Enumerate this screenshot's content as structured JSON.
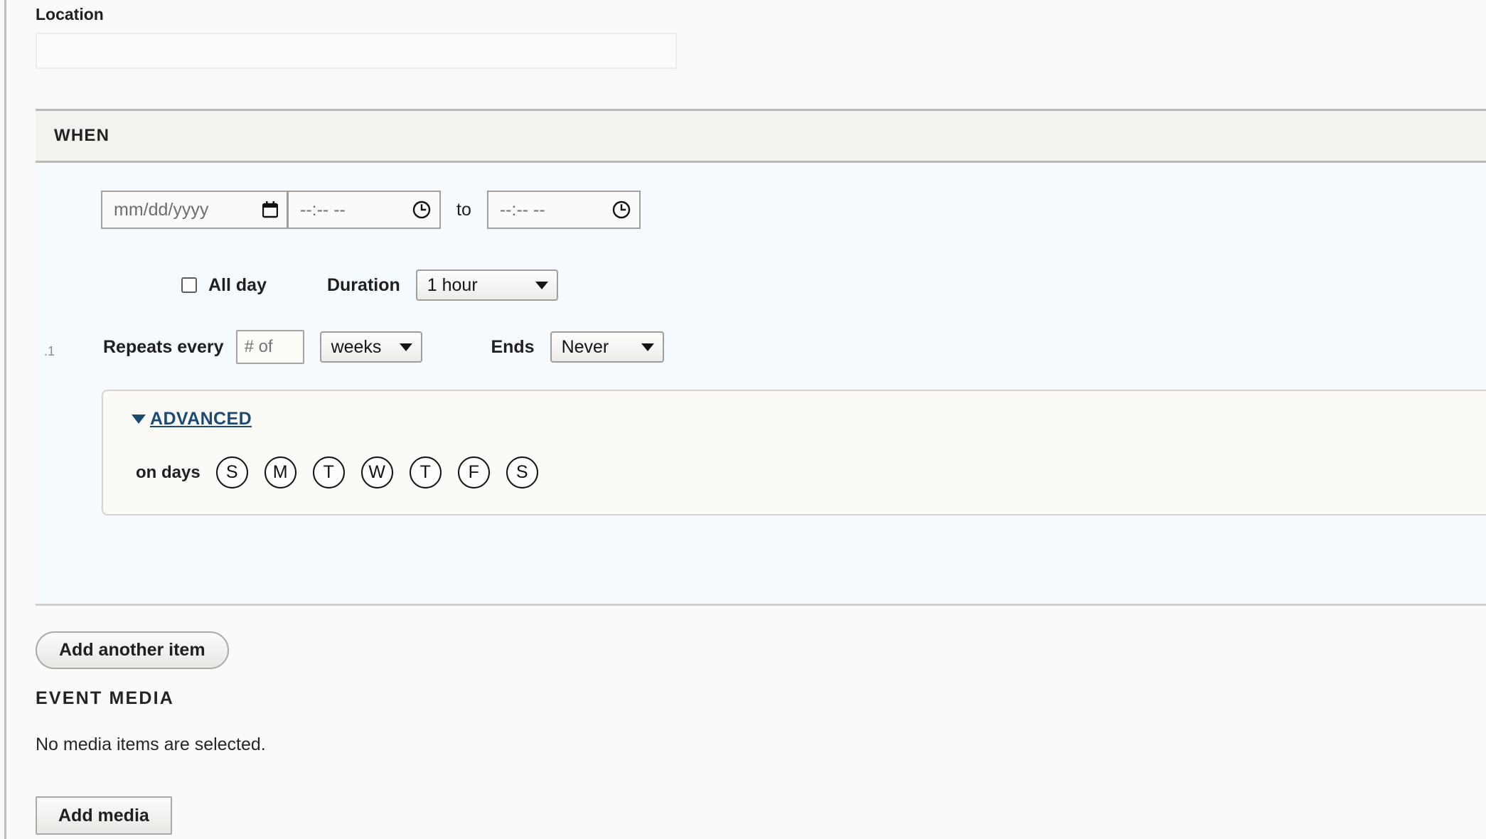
{
  "location": {
    "label": "Location",
    "value": "",
    "placeholder": ""
  },
  "when": {
    "section_title": "WHEN",
    "date": {
      "placeholder": "mm/dd/yyyy",
      "value": "",
      "icon": "calendar-icon"
    },
    "start_time": {
      "placeholder": "--:-- --",
      "value": "",
      "icon": "clock-icon"
    },
    "to_label": "to",
    "end_time": {
      "placeholder": "--:-- --",
      "value": "",
      "icon": "clock-icon"
    },
    "all_day": {
      "label": "All day",
      "checked": false
    },
    "duration": {
      "label": "Duration",
      "value": "1 hour",
      "options": [
        "1 hour"
      ]
    },
    "repeats": {
      "label": "Repeats every",
      "count_placeholder": "# of",
      "count_value": "",
      "unit_value": "weeks",
      "unit_options": [
        "weeks"
      ]
    },
    "ends": {
      "label": "Ends",
      "value": "Never",
      "options": [
        "Never"
      ]
    },
    "tiny_mark": ".1",
    "advanced": {
      "link_label": "ADVANCED",
      "caret": "triangle-down-icon",
      "on_days_label": "on days",
      "days": [
        {
          "letter": "S",
          "name": "sunday",
          "selected": false
        },
        {
          "letter": "M",
          "name": "monday",
          "selected": false
        },
        {
          "letter": "T",
          "name": "tuesday",
          "selected": false
        },
        {
          "letter": "W",
          "name": "wednesday",
          "selected": false
        },
        {
          "letter": "T",
          "name": "thursday",
          "selected": false
        },
        {
          "letter": "F",
          "name": "friday",
          "selected": false
        },
        {
          "letter": "S",
          "name": "saturday",
          "selected": false
        }
      ]
    }
  },
  "add_another_item_label": "Add another item",
  "event_media": {
    "title": "EVENT MEDIA",
    "empty_text": "No media items are selected.",
    "add_media_label": "Add media"
  },
  "colors": {
    "page_background": "#fbfaf8",
    "section_header_background": "#f2f3ee",
    "when_body_background": "#f5faff",
    "link_blue": "#1b4a75",
    "border_gray": "#b9bab5"
  }
}
